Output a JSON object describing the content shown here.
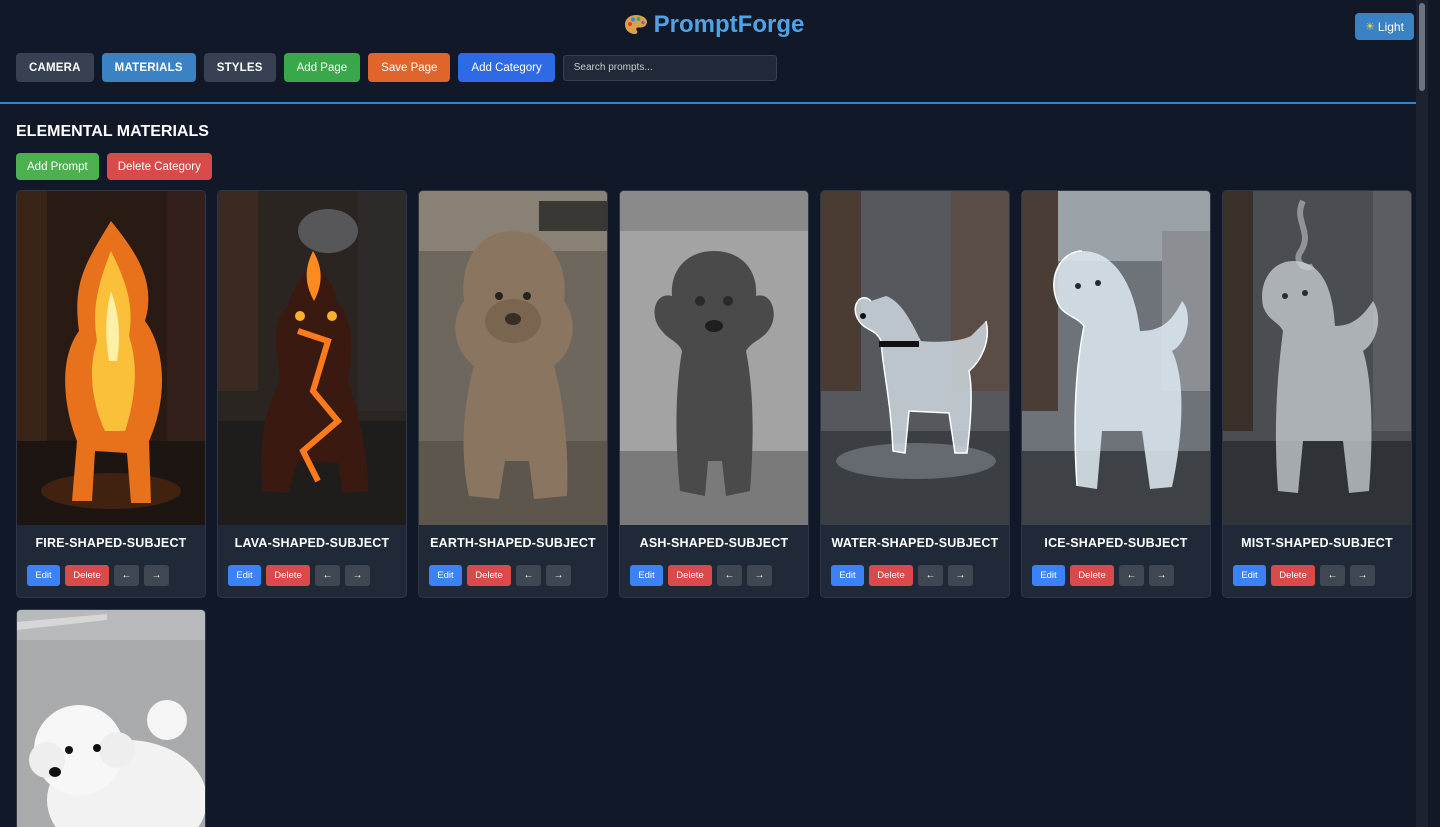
{
  "app": {
    "title": "PromptForge",
    "theme_toggle": "Light"
  },
  "toolbar": {
    "categories": [
      {
        "label": "CAMERA",
        "active": false
      },
      {
        "label": "MATERIALS",
        "active": true
      },
      {
        "label": "STYLES",
        "active": false
      }
    ],
    "add_page": "Add Page",
    "save_page": "Save Page",
    "add_category": "Add Category",
    "search_placeholder": "Search prompts..."
  },
  "section": {
    "title": "ELEMENTAL MATERIALS",
    "add_prompt": "Add Prompt",
    "delete_category": "Delete Category"
  },
  "card_actions": {
    "edit": "Edit",
    "delete": "Delete",
    "left": "←",
    "right": "→"
  },
  "prompts": [
    {
      "name": "FIRE-SHAPED-SUBJECT"
    },
    {
      "name": "LAVA-SHAPED-SUBJECT"
    },
    {
      "name": "EARTH-SHAPED-SUBJECT"
    },
    {
      "name": "ASH-SHAPED-SUBJECT"
    },
    {
      "name": "WATER-SHAPED-SUBJECT"
    },
    {
      "name": "ICE-SHAPED-SUBJECT"
    },
    {
      "name": "MIST-SHAPED-SUBJECT"
    },
    {
      "name": ""
    }
  ],
  "colors": {
    "accent": "#3b82c4",
    "background": "#111827",
    "card": "#1f2937",
    "success": "#4caf50",
    "danger": "#d94a4a"
  },
  "icons": {
    "logo": "palette-icon",
    "theme": "sun-icon"
  }
}
